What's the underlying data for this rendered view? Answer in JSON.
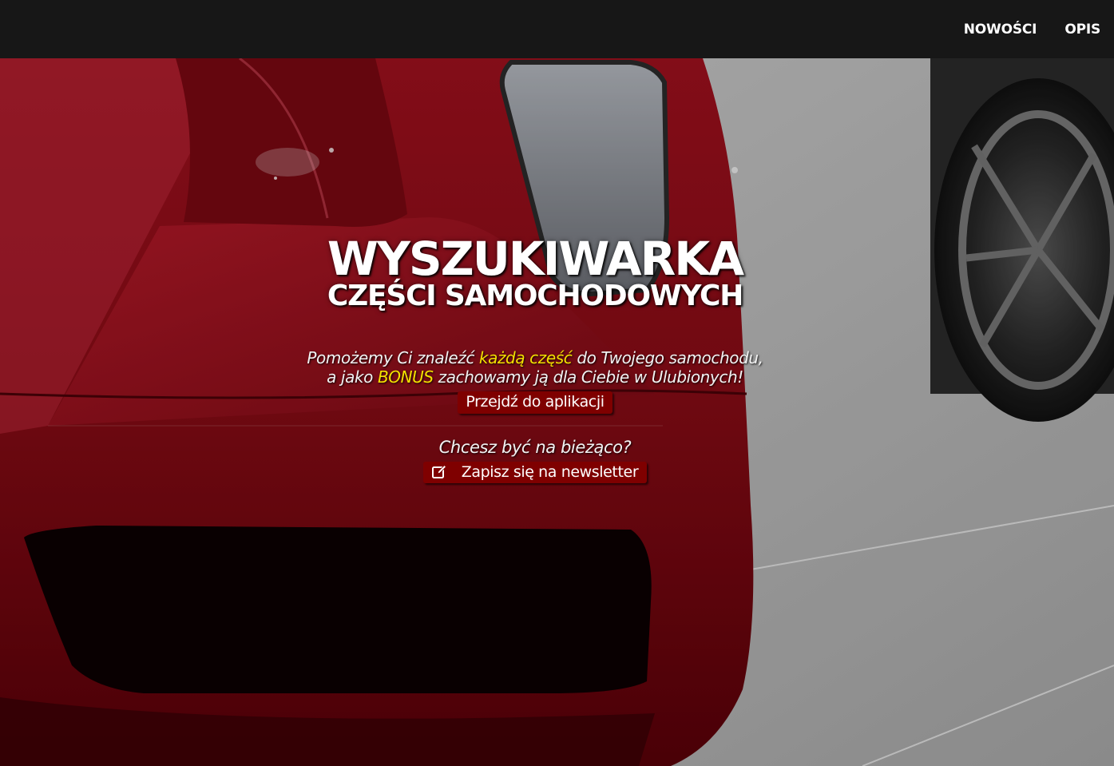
{
  "nav": {
    "items": [
      {
        "label": "NOWOŚCI"
      },
      {
        "label": "OPIS"
      }
    ]
  },
  "hero": {
    "title": "WYSZUKIWARKA",
    "subtitle": "CZĘŚCI SAMOCHODOWYCH",
    "tagline": {
      "line1_a": "Pomożemy Ci znaleźć ",
      "line1_highlight": "każdą część",
      "line1_b": " do Twojego samochodu,",
      "line2_a": "a jako ",
      "line2_highlight": "BONUS",
      "line2_b": " zachowamy ją dla Ciebie w Ulubionych!"
    },
    "app_button_label": "Przejdź do aplikacji",
    "newsletter_question": "Chcesz być na bieżąco?",
    "newsletter_button_label": "Zapisz się na newsletter",
    "newsletter_icon": "edit-icon",
    "background": "red sports car photo"
  },
  "colors": {
    "navbar": "#171717",
    "accent": "#7f0000",
    "highlight": "#f3e100"
  }
}
